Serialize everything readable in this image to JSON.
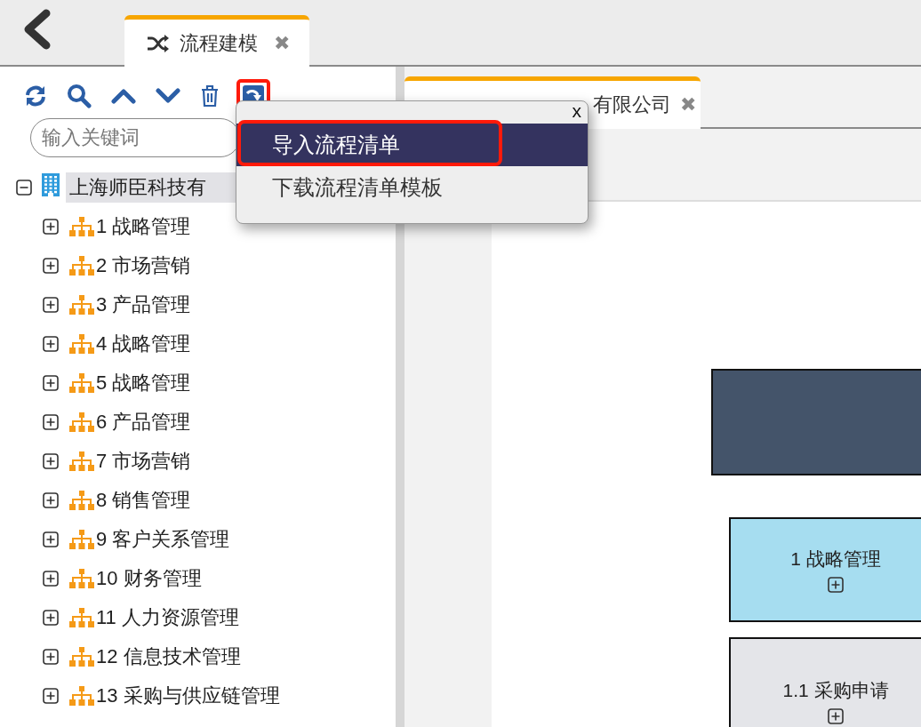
{
  "top_tabs": [
    {
      "label": "流程建模",
      "close": "✖",
      "selected": true
    }
  ],
  "toolbar": [
    {
      "kind": "refresh",
      "annotated": false
    },
    {
      "kind": "search",
      "annotated": false
    },
    {
      "kind": "up",
      "annotated": false
    },
    {
      "kind": "down",
      "annotated": false
    },
    {
      "kind": "delete",
      "annotated": false
    },
    {
      "kind": "import",
      "annotated": true
    }
  ],
  "search": {
    "placeholder": "输入关键词"
  },
  "tree": {
    "label": "上海师臣科技有",
    "expanded": true,
    "selected": true,
    "children": [
      {
        "label": "1 战略管理",
        "expanded": false,
        "selected": false
      },
      {
        "label": "2 市场营销",
        "expanded": false,
        "selected": false
      },
      {
        "label": "3 产品管理",
        "expanded": false,
        "selected": false
      },
      {
        "label": "4 战略管理",
        "expanded": false,
        "selected": false
      },
      {
        "label": "5 战略管理",
        "expanded": false,
        "selected": false
      },
      {
        "label": "6 产品管理",
        "expanded": false,
        "selected": false
      },
      {
        "label": "7 市场营销",
        "expanded": false,
        "selected": false
      },
      {
        "label": "8 销售管理",
        "expanded": false,
        "selected": false
      },
      {
        "label": "9 客户关系管理",
        "expanded": false,
        "selected": false
      },
      {
        "label": "10 财务管理",
        "expanded": false,
        "selected": false
      },
      {
        "label": "11 人力资源管理",
        "expanded": false,
        "selected": false
      },
      {
        "label": "12 信息技术管理",
        "expanded": false,
        "selected": false
      },
      {
        "label": "13 采购与供应链管理",
        "expanded": false,
        "selected": false
      }
    ]
  },
  "doc_tabs": [
    {
      "label": "有限公司",
      "close": "✖",
      "selected": true
    }
  ],
  "diagram": {
    "nodes": [
      {
        "kind": "company"
      },
      {
        "kind": "process",
        "label": "1 战略管理",
        "expanded": false
      },
      {
        "kind": "subprocess",
        "label": "1.1 采购申请",
        "expanded": false
      }
    ]
  },
  "popup": {
    "close": "x",
    "items": [
      {
        "label": "导入流程清单",
        "selected": true,
        "annotated": true
      },
      {
        "label": "下载流程清单模板",
        "selected": false,
        "annotated": false
      }
    ]
  }
}
